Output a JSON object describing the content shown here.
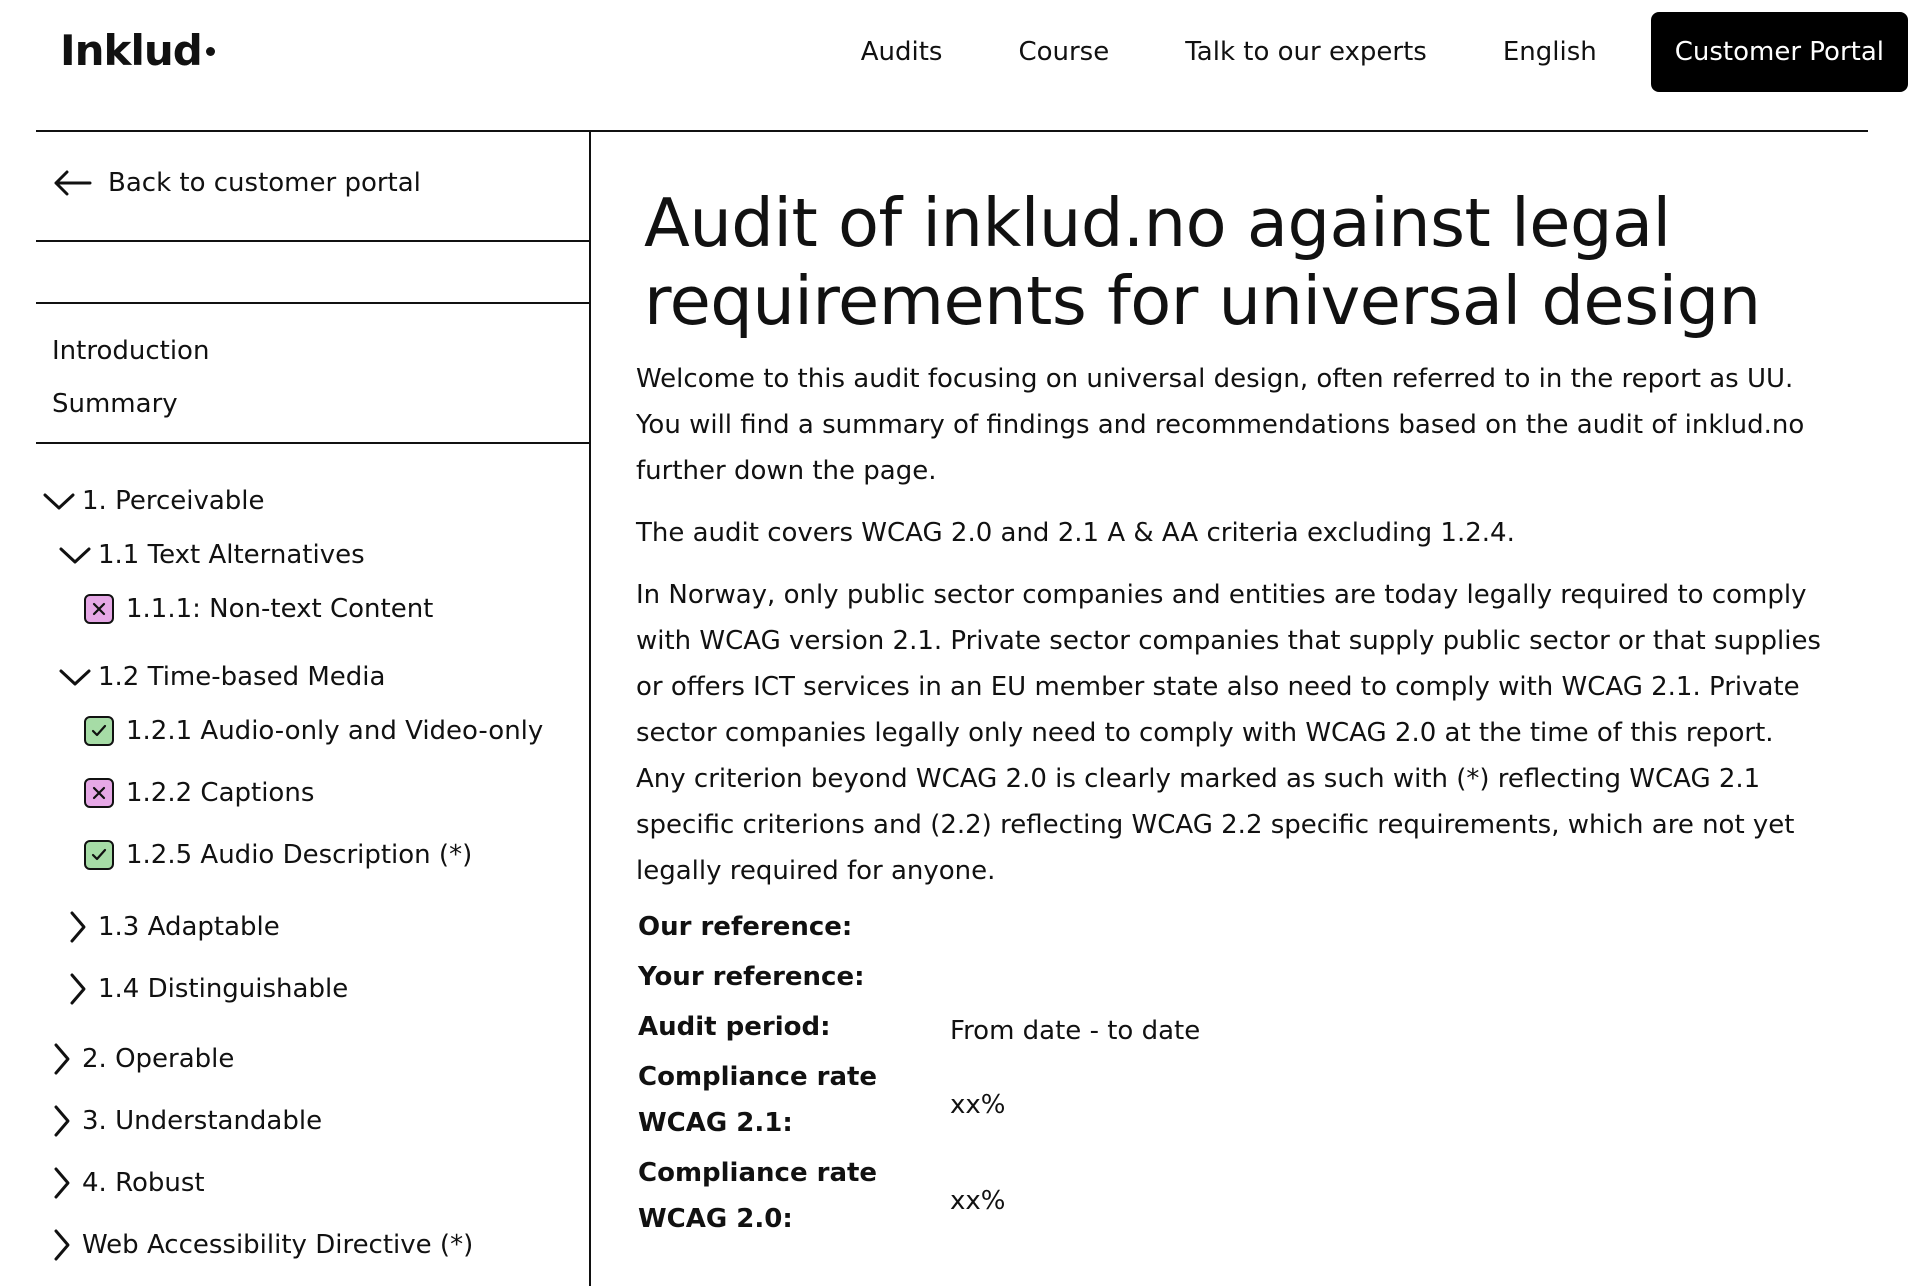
{
  "header": {
    "logo": "Inklud",
    "nav": [
      {
        "label": "Audits"
      },
      {
        "label": "Course"
      },
      {
        "label": "Talk to our experts"
      },
      {
        "label": "English"
      }
    ],
    "portal_button": "Customer Portal"
  },
  "sidebar": {
    "back_label": "Back to customer portal",
    "links": [
      "Introduction",
      "Summary"
    ],
    "tree": {
      "perceivable": "1. Perceivable",
      "text_alternatives": "1.1 Text Alternatives",
      "c111": {
        "label": "1.1.1: Non-text Content",
        "status": "fail"
      },
      "time_based": "1.2 Time-based Media",
      "c121": {
        "label": "1.2.1 Audio-only and Video-only",
        "status": "pass"
      },
      "c122": {
        "label": "1.2.2 Captions",
        "status": "fail"
      },
      "c125": {
        "label": "1.2.5 Audio Description (*)",
        "status": "pass"
      },
      "adaptable": "1.3 Adaptable",
      "distinguishable": "1.4 Distinguishable",
      "operable": "2. Operable",
      "understandable": "3. Understandable",
      "robust": "4. Robust",
      "wad": "Web Accessibility Directive (*)"
    }
  },
  "main": {
    "title": "Audit of inklud.no against legal requirements for universal design",
    "paragraphs": [
      "Welcome to this audit focusing on universal design, often referred to in the report as UU. You will find a summary of findings and recommendations based on the audit of inklud.no further down the page.",
      "The audit covers WCAG 2.0 and 2.1 A & AA criteria excluding 1.2.4.",
      "In Norway, only public sector companies and entities are today legally required to comply with WCAG version 2.1. Private sector companies that supply public sector or that supplies or offers ICT services in an EU member state also need to comply with WCAG 2.1. Private sector companies legally only need to comply with WCAG 2.0 at the time of this report. Any criterion beyond WCAG 2.0 is clearly marked as such with (*) reflecting WCAG 2.1 specific criterions and (2.2) reflecting WCAG 2.2 specific requirements, which are not yet legally required for anyone."
    ],
    "meta": {
      "our_reference": {
        "label": "Our reference:",
        "value": ""
      },
      "your_reference": {
        "label": "Your reference:",
        "value": ""
      },
      "audit_period": {
        "label": "Audit period:",
        "value": "From date - to date"
      },
      "compliance_21": {
        "label": "Compliance rate WCAG 2.1:",
        "value": "xx%"
      },
      "compliance_20": {
        "label": "Compliance rate WCAG 2.0:",
        "value": "xx%"
      }
    }
  },
  "colors": {
    "fail_badge": "#e6a8e6",
    "pass_badge": "#a6dca6",
    "portal_button_bg": "#000000"
  }
}
